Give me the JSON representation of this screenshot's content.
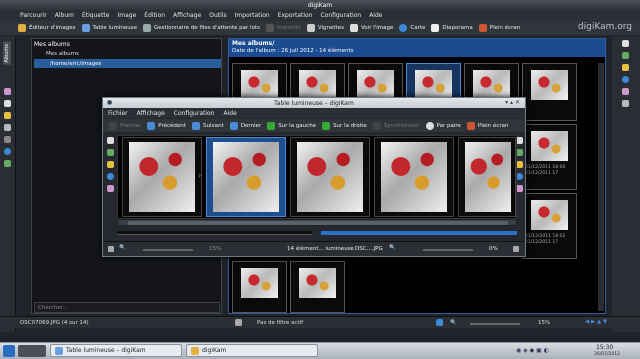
{
  "main_window": {
    "title": "digiKam",
    "menu": [
      "Parcourir",
      "Album",
      "Étiquette",
      "Image",
      "Édition",
      "Affichage",
      "Outils",
      "Importation",
      "Exportation",
      "Configuration",
      "Aide"
    ],
    "toolbar": [
      {
        "label": "Éditeur d'images",
        "icon": "image-editor-icon",
        "enabled": true
      },
      {
        "label": "Table lumineuse",
        "icon": "light-table-icon",
        "enabled": true
      },
      {
        "label": "Gestionnaire de files d'attente par lots",
        "icon": "batch-queue-icon",
        "enabled": true
      },
      {
        "label": "Importer",
        "icon": "import-icon",
        "enabled": false
      },
      {
        "label": "Vignettes",
        "icon": "thumbnails-icon",
        "enabled": true
      },
      {
        "label": "Voir l'image",
        "icon": "view-image-icon",
        "enabled": true
      },
      {
        "label": "Carte",
        "icon": "map-icon",
        "enabled": true
      },
      {
        "label": "Diaporama",
        "icon": "slideshow-icon",
        "enabled": true
      },
      {
        "label": "Plein écran",
        "icon": "fullscreen-icon",
        "enabled": true
      }
    ],
    "brand": "digiKam.org",
    "left_sidebar_tab": "Albums",
    "albums_panel": {
      "header": "Mes albums",
      "root": "Mes albums",
      "selected": "/home/eric/images",
      "search_placeholder": "Chercher..."
    },
    "album_view": {
      "title": "Mes albums/",
      "subtitle": "Date de l'album : 26 juil 2012 - 14 éléments"
    },
    "thumb_captions": [
      {
        "name": "DSC07074.JPG",
        "date": "21/12/2011 18:00",
        "size": "21/12/2011 17"
      },
      {
        "name": "DSC07075.JPG",
        "date": "21/12/2011 18:02",
        "size": "21/12/2011 17"
      }
    ],
    "status": {
      "left": "DSC07069.JPG (4 sur 14)",
      "filter": "Pas de filtre actif",
      "zoom": "15%"
    }
  },
  "light_table": {
    "title": "Table lumineuse – digiKam",
    "menu": [
      "Fichier",
      "Affichage",
      "Configuration",
      "Aide"
    ],
    "toolbar": [
      {
        "label": "Premier",
        "enabled": false
      },
      {
        "label": "Précédent",
        "enabled": true
      },
      {
        "label": "Suivant",
        "enabled": true
      },
      {
        "label": "Dernier",
        "enabled": true
      },
      {
        "label": "Sur la gauche",
        "enabled": true
      },
      {
        "label": "Sur la droite",
        "enabled": true
      },
      {
        "label": "Synchroniser",
        "enabled": false
      },
      {
        "label": "Par paire",
        "enabled": true
      },
      {
        "label": "Plein écran",
        "enabled": true
      }
    ],
    "status": {
      "left_zoom": "15%",
      "center": "14 élément... lumineuse",
      "file": "DSC....JPG",
      "right_zoom": "0%"
    }
  },
  "taskbar": {
    "items": [
      "Table lumineuse – digiKam",
      "digiKam"
    ],
    "clock": "15:30",
    "date": "26/07/2012"
  }
}
